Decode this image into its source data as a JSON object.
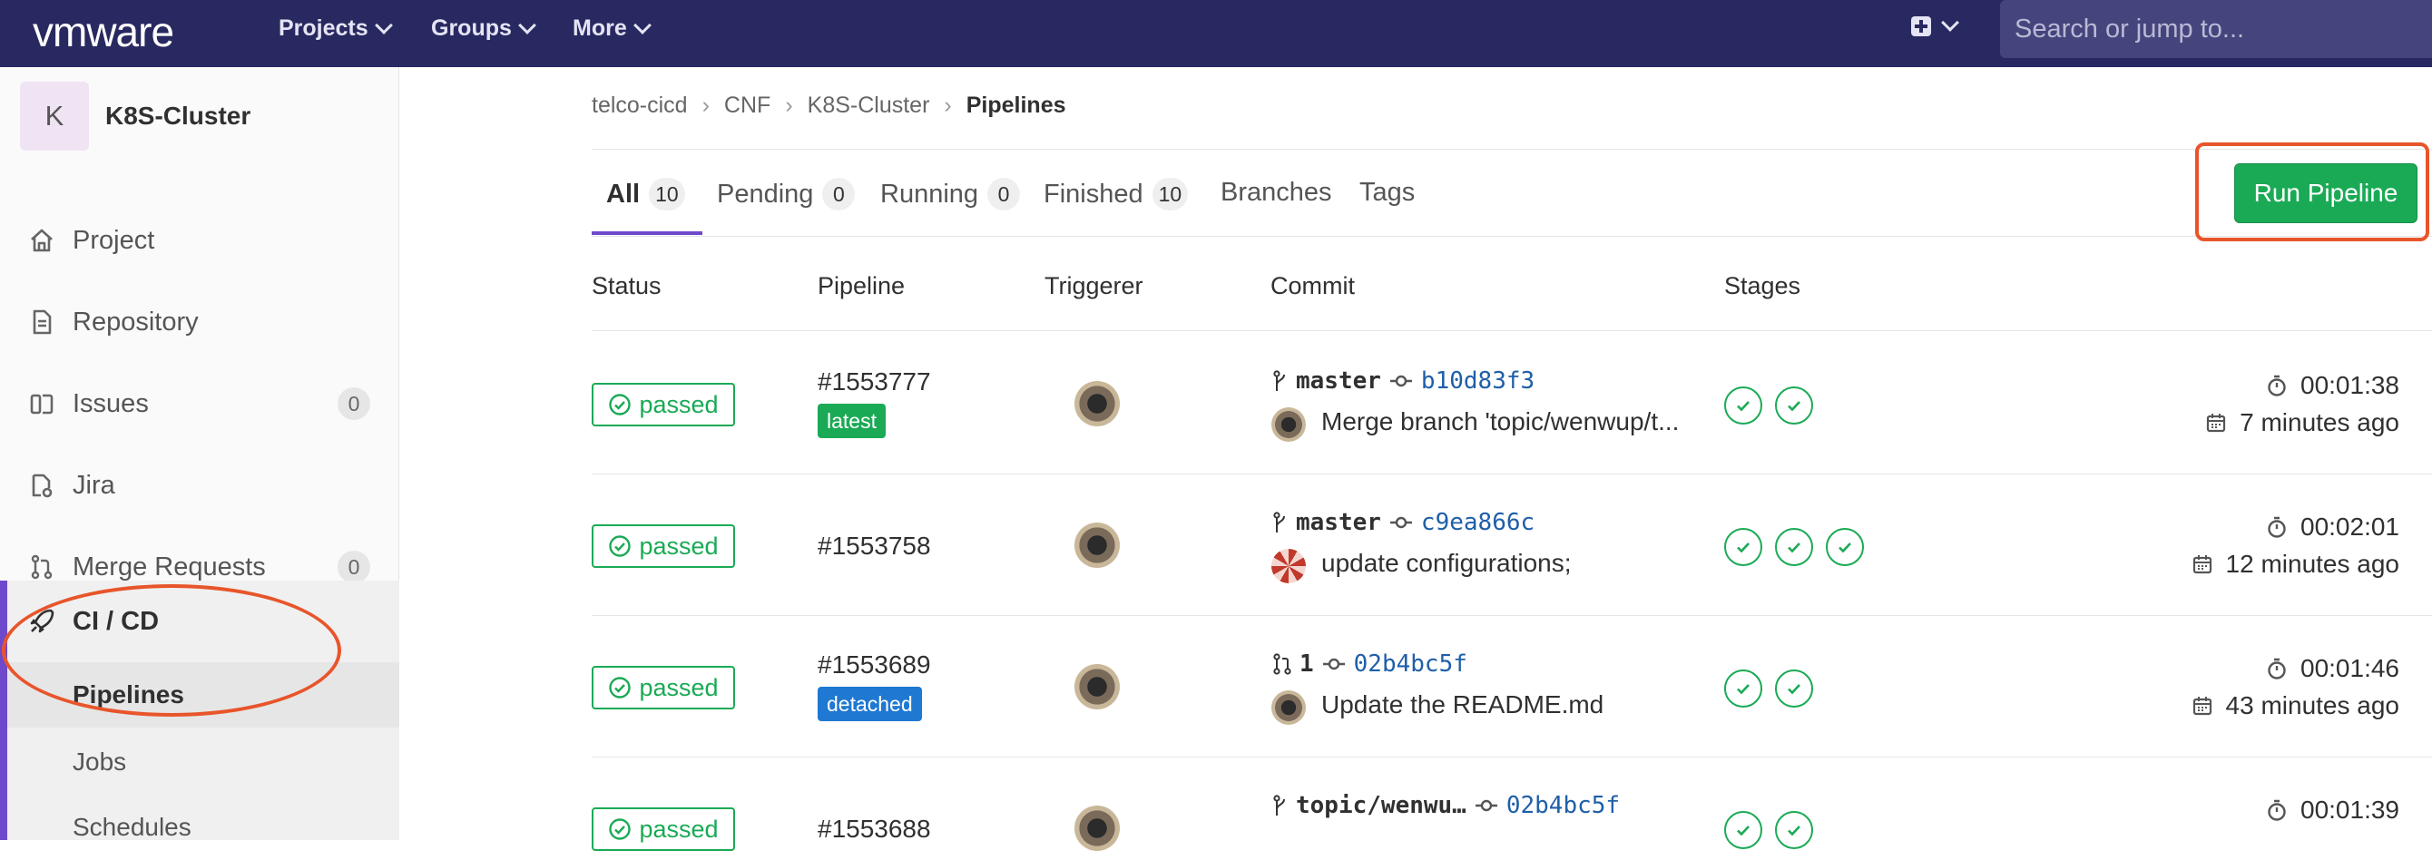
{
  "topbar": {
    "logo": "vmware",
    "nav": [
      "Projects",
      "Groups",
      "More"
    ],
    "search_placeholder": "Search or jump to..."
  },
  "sidebar": {
    "project_initial": "K",
    "project_name": "K8S-Cluster",
    "items": [
      {
        "label": "Project",
        "icon": "home-icon"
      },
      {
        "label": "Repository",
        "icon": "document-icon"
      },
      {
        "label": "Issues",
        "icon": "issues-icon",
        "count": "0"
      },
      {
        "label": "Jira",
        "icon": "jira-icon"
      },
      {
        "label": "Merge Requests",
        "icon": "merge-request-icon",
        "count": "0"
      }
    ],
    "cicd": {
      "label": "CI / CD",
      "sub": [
        "Pipelines",
        "Jobs",
        "Schedules"
      ]
    }
  },
  "breadcrumb": [
    "telco-cicd",
    "CNF",
    "K8S-Cluster",
    "Pipelines"
  ],
  "tabs": [
    {
      "label": "All",
      "count": "10"
    },
    {
      "label": "Pending",
      "count": "0"
    },
    {
      "label": "Running",
      "count": "0"
    },
    {
      "label": "Finished",
      "count": "10"
    },
    {
      "label": "Branches"
    },
    {
      "label": "Tags"
    }
  ],
  "run_button": "Run Pipeline",
  "table": {
    "headers": [
      "Status",
      "Pipeline",
      "Triggerer",
      "Commit",
      "Stages"
    ],
    "rows": [
      {
        "status": "passed",
        "id": "#1553777",
        "tag": "latest",
        "ref": "master",
        "sha": "b10d83f3",
        "message": "Merge branch 'topic/wenwup/t...",
        "stages": 2,
        "duration": "00:01:38",
        "ago": "7 minutes ago"
      },
      {
        "status": "passed",
        "id": "#1553758",
        "tag": "",
        "ref": "master",
        "sha": "c9ea866c",
        "message": "update configurations;",
        "stages": 3,
        "duration": "00:02:01",
        "ago": "12 minutes ago"
      },
      {
        "status": "passed",
        "id": "#1553689",
        "tag": "detached",
        "ref": "1",
        "sha": "02b4bc5f",
        "message": "Update the README.md",
        "stages": 2,
        "duration": "00:01:46",
        "ago": "43 minutes ago"
      },
      {
        "status": "passed",
        "id": "#1553688",
        "tag": "",
        "ref": "topic/wenwu…",
        "sha": "02b4bc5f",
        "message": "",
        "stages": 2,
        "duration": "00:01:39",
        "ago": ""
      }
    ]
  },
  "colors": {
    "navbar": "#292961",
    "success": "#1aaa55",
    "accent": "#6e49cb",
    "highlight": "#e8552b",
    "link": "#1f5fa8"
  }
}
